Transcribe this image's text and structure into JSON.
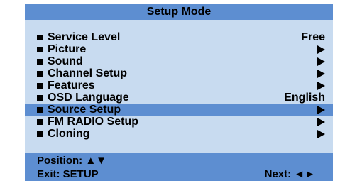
{
  "window": {
    "title": "Setup Mode"
  },
  "menu": {
    "items": [
      {
        "label": "Service Level",
        "value": "Free",
        "has_submenu": false,
        "selected": false
      },
      {
        "label": "Picture",
        "value": "",
        "has_submenu": true,
        "selected": false
      },
      {
        "label": "Sound",
        "value": "",
        "has_submenu": true,
        "selected": false
      },
      {
        "label": "Channel Setup",
        "value": "",
        "has_submenu": true,
        "selected": false
      },
      {
        "label": "Features",
        "value": "",
        "has_submenu": true,
        "selected": false
      },
      {
        "label": "OSD Language",
        "value": "English",
        "has_submenu": false,
        "selected": false
      },
      {
        "label": "Source Setup",
        "value": "",
        "has_submenu": true,
        "selected": true
      },
      {
        "label": "FM RADIO Setup",
        "value": "",
        "has_submenu": true,
        "selected": false
      },
      {
        "label": "Cloning",
        "value": "",
        "has_submenu": true,
        "selected": false
      }
    ]
  },
  "footer": {
    "position_hint": "Position: ▲▼",
    "exit_hint": "Exit: SETUP",
    "next_hint": "Next: ◄►"
  },
  "colors": {
    "panel_background": "#c8dbf0",
    "bar_accent": "#5d8ed1",
    "text": "#000000"
  },
  "icons": {
    "bullet": "square-bullet-icon",
    "submenu": "arrow-right-icon"
  }
}
